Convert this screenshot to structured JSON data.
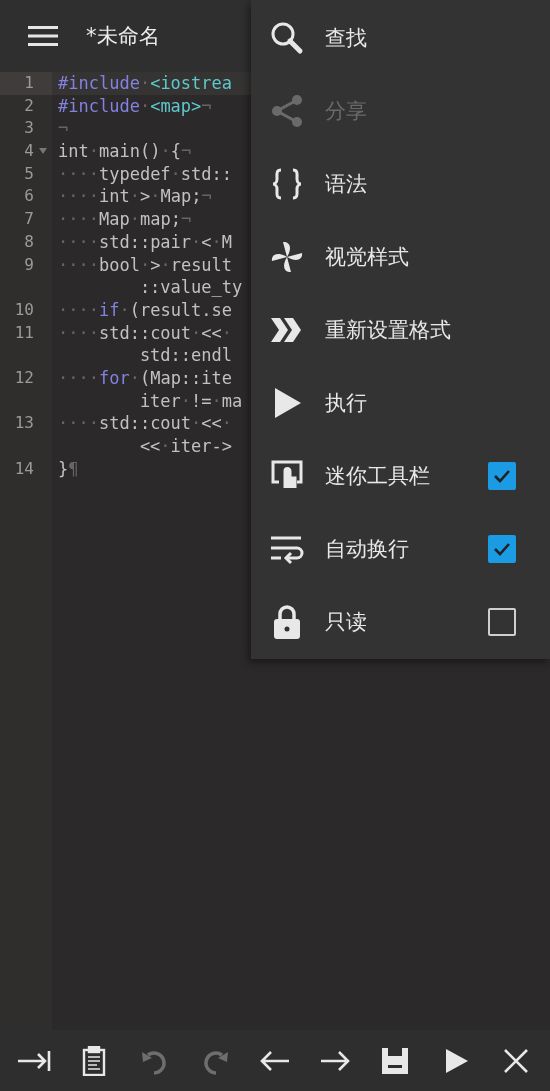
{
  "app_bar": {
    "title": "*未命名"
  },
  "editor": {
    "rows": [
      {
        "number": "1",
        "current": true,
        "fold": false,
        "continuation": false,
        "segments": [
          {
            "kind": "kw",
            "text": "#include"
          },
          {
            "kind": "mk",
            "text": "·"
          },
          {
            "kind": "str",
            "text": "<iostrea"
          }
        ]
      },
      {
        "number": "2",
        "current": false,
        "fold": false,
        "continuation": false,
        "segments": [
          {
            "kind": "kw",
            "text": "#include"
          },
          {
            "kind": "mk",
            "text": "·"
          },
          {
            "kind": "str",
            "text": "<map>"
          },
          {
            "kind": "mk",
            "text": "¬"
          }
        ]
      },
      {
        "number": "3",
        "current": false,
        "fold": false,
        "continuation": false,
        "segments": [
          {
            "kind": "mk",
            "text": "¬"
          }
        ]
      },
      {
        "number": "4",
        "current": false,
        "fold": true,
        "continuation": false,
        "segments": [
          {
            "kind": "pl",
            "text": "int"
          },
          {
            "kind": "mk",
            "text": "·"
          },
          {
            "kind": "pl",
            "text": "main()"
          },
          {
            "kind": "mk",
            "text": "·"
          },
          {
            "kind": "pl",
            "text": "{"
          },
          {
            "kind": "mk",
            "text": "¬"
          }
        ]
      },
      {
        "number": "5",
        "current": false,
        "fold": false,
        "continuation": false,
        "segments": [
          {
            "kind": "mk",
            "text": "····"
          },
          {
            "kind": "pl",
            "text": "typedef"
          },
          {
            "kind": "mk",
            "text": "·"
          },
          {
            "kind": "pl",
            "text": "std::"
          }
        ]
      },
      {
        "number": "6",
        "current": false,
        "fold": false,
        "continuation": false,
        "segments": [
          {
            "kind": "mk",
            "text": "····"
          },
          {
            "kind": "pl",
            "text": "int"
          },
          {
            "kind": "mk",
            "text": "·"
          },
          {
            "kind": "pl",
            "text": ">"
          },
          {
            "kind": "mk",
            "text": "·"
          },
          {
            "kind": "pl",
            "text": "Map;"
          },
          {
            "kind": "mk",
            "text": "¬"
          }
        ]
      },
      {
        "number": "7",
        "current": false,
        "fold": false,
        "continuation": false,
        "segments": [
          {
            "kind": "mk",
            "text": "····"
          },
          {
            "kind": "pl",
            "text": "Map"
          },
          {
            "kind": "mk",
            "text": "·"
          },
          {
            "kind": "pl",
            "text": "map;"
          },
          {
            "kind": "mk",
            "text": "¬"
          }
        ]
      },
      {
        "number": "8",
        "current": false,
        "fold": false,
        "continuation": false,
        "segments": [
          {
            "kind": "mk",
            "text": "····"
          },
          {
            "kind": "pl",
            "text": "std::pair"
          },
          {
            "kind": "mk",
            "text": "·"
          },
          {
            "kind": "pl",
            "text": "<"
          },
          {
            "kind": "mk",
            "text": "·"
          },
          {
            "kind": "pl",
            "text": "M"
          }
        ]
      },
      {
        "number": "9",
        "current": false,
        "fold": false,
        "continuation": false,
        "segments": [
          {
            "kind": "mk",
            "text": "····"
          },
          {
            "kind": "pl",
            "text": "bool"
          },
          {
            "kind": "mk",
            "text": "·"
          },
          {
            "kind": "pl",
            "text": ">"
          },
          {
            "kind": "mk",
            "text": "·"
          },
          {
            "kind": "pl",
            "text": "result"
          }
        ]
      },
      {
        "current": false,
        "fold": false,
        "continuation": true,
        "segments": [
          {
            "kind": "pl",
            "text": "::value_ty"
          }
        ]
      },
      {
        "number": "10",
        "current": false,
        "fold": false,
        "continuation": false,
        "segments": [
          {
            "kind": "mk",
            "text": "····"
          },
          {
            "kind": "kw",
            "text": "if"
          },
          {
            "kind": "mk",
            "text": "·"
          },
          {
            "kind": "pl",
            "text": "(result.se"
          }
        ]
      },
      {
        "number": "11",
        "current": false,
        "fold": false,
        "continuation": false,
        "segments": [
          {
            "kind": "mk",
            "text": "····"
          },
          {
            "kind": "pl",
            "text": "std::cout"
          },
          {
            "kind": "mk",
            "text": "·"
          },
          {
            "kind": "pl",
            "text": "<<"
          },
          {
            "kind": "mk",
            "text": "·"
          }
        ]
      },
      {
        "current": false,
        "fold": false,
        "continuation": true,
        "segments": [
          {
            "kind": "pl",
            "text": "std::endl"
          }
        ]
      },
      {
        "number": "12",
        "current": false,
        "fold": false,
        "continuation": false,
        "segments": [
          {
            "kind": "mk",
            "text": "····"
          },
          {
            "kind": "kw",
            "text": "for"
          },
          {
            "kind": "mk",
            "text": "·"
          },
          {
            "kind": "pl",
            "text": "(Map::ite"
          }
        ]
      },
      {
        "current": false,
        "fold": false,
        "continuation": true,
        "segments": [
          {
            "kind": "pl",
            "text": "iter"
          },
          {
            "kind": "mk",
            "text": "·"
          },
          {
            "kind": "pl",
            "text": "!="
          },
          {
            "kind": "mk",
            "text": "·"
          },
          {
            "kind": "pl",
            "text": "ma"
          }
        ]
      },
      {
        "number": "13",
        "current": false,
        "fold": false,
        "continuation": false,
        "segments": [
          {
            "kind": "mk",
            "text": "····"
          },
          {
            "kind": "pl",
            "text": "std::cout"
          },
          {
            "kind": "mk",
            "text": "·"
          },
          {
            "kind": "pl",
            "text": "<<"
          },
          {
            "kind": "mk",
            "text": "·"
          }
        ]
      },
      {
        "current": false,
        "fold": false,
        "continuation": true,
        "segments": [
          {
            "kind": "pl",
            "text": "<<"
          },
          {
            "kind": "mk",
            "text": "·"
          },
          {
            "kind": "pl",
            "text": "iter->"
          }
        ]
      },
      {
        "number": "14",
        "current": false,
        "fold": false,
        "continuation": false,
        "segments": [
          {
            "kind": "pl",
            "text": "}"
          },
          {
            "kind": "mk",
            "text": "¶"
          }
        ]
      }
    ]
  },
  "menu": {
    "items": [
      {
        "kind": "search",
        "label": "查找",
        "disabled": false
      },
      {
        "kind": "share",
        "label": "分享",
        "disabled": true
      },
      {
        "kind": "syntax",
        "label": "语法",
        "disabled": false
      },
      {
        "kind": "style",
        "label": "视觉样式",
        "disabled": false
      },
      {
        "kind": "format",
        "label": "重新设置格式",
        "disabled": false
      },
      {
        "kind": "run",
        "label": "执行",
        "disabled": false
      },
      {
        "kind": "toolbar",
        "label": "迷你工具栏",
        "disabled": false,
        "checked": true
      },
      {
        "kind": "wrap",
        "label": "自动换行",
        "disabled": false,
        "checked": true
      },
      {
        "kind": "lock",
        "label": "只读",
        "disabled": false,
        "checked": false
      }
    ]
  },
  "toolbar": [
    {
      "kind": "tab",
      "disabled": false
    },
    {
      "kind": "paste",
      "disabled": false
    },
    {
      "kind": "undo",
      "disabled": true
    },
    {
      "kind": "redo",
      "disabled": true
    },
    {
      "kind": "left",
      "disabled": false
    },
    {
      "kind": "right",
      "disabled": false
    },
    {
      "kind": "save",
      "disabled": false
    },
    {
      "kind": "run",
      "disabled": false
    },
    {
      "kind": "close",
      "disabled": false
    }
  ]
}
